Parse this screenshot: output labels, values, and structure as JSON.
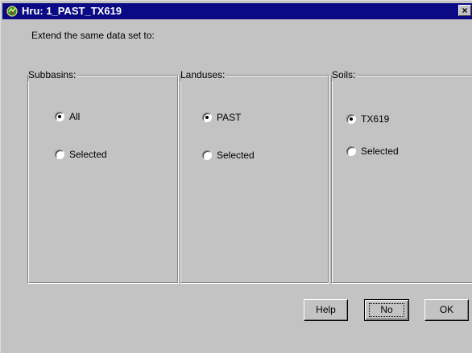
{
  "window": {
    "title": "Hru: 1_PAST_TX619",
    "close_glyph": "×",
    "icon": "app-icon"
  },
  "prompt": "Extend the same data set to:",
  "groups": [
    {
      "title": "Subbasins:",
      "options": [
        {
          "label": "All",
          "checked": true
        },
        {
          "label": "Selected",
          "checked": false
        }
      ]
    },
    {
      "title": "Landuses:",
      "options": [
        {
          "label": "PAST",
          "checked": true
        },
        {
          "label": "Selected",
          "checked": false
        }
      ]
    },
    {
      "title": "Soils:",
      "options": [
        {
          "label": "TX619",
          "checked": true
        },
        {
          "label": "Selected",
          "checked": false
        }
      ]
    }
  ],
  "buttons": {
    "help": "Help",
    "no": "No",
    "ok": "OK"
  },
  "colors": {
    "titlebar": "#0a0a84",
    "face": "#c3c3c3"
  }
}
